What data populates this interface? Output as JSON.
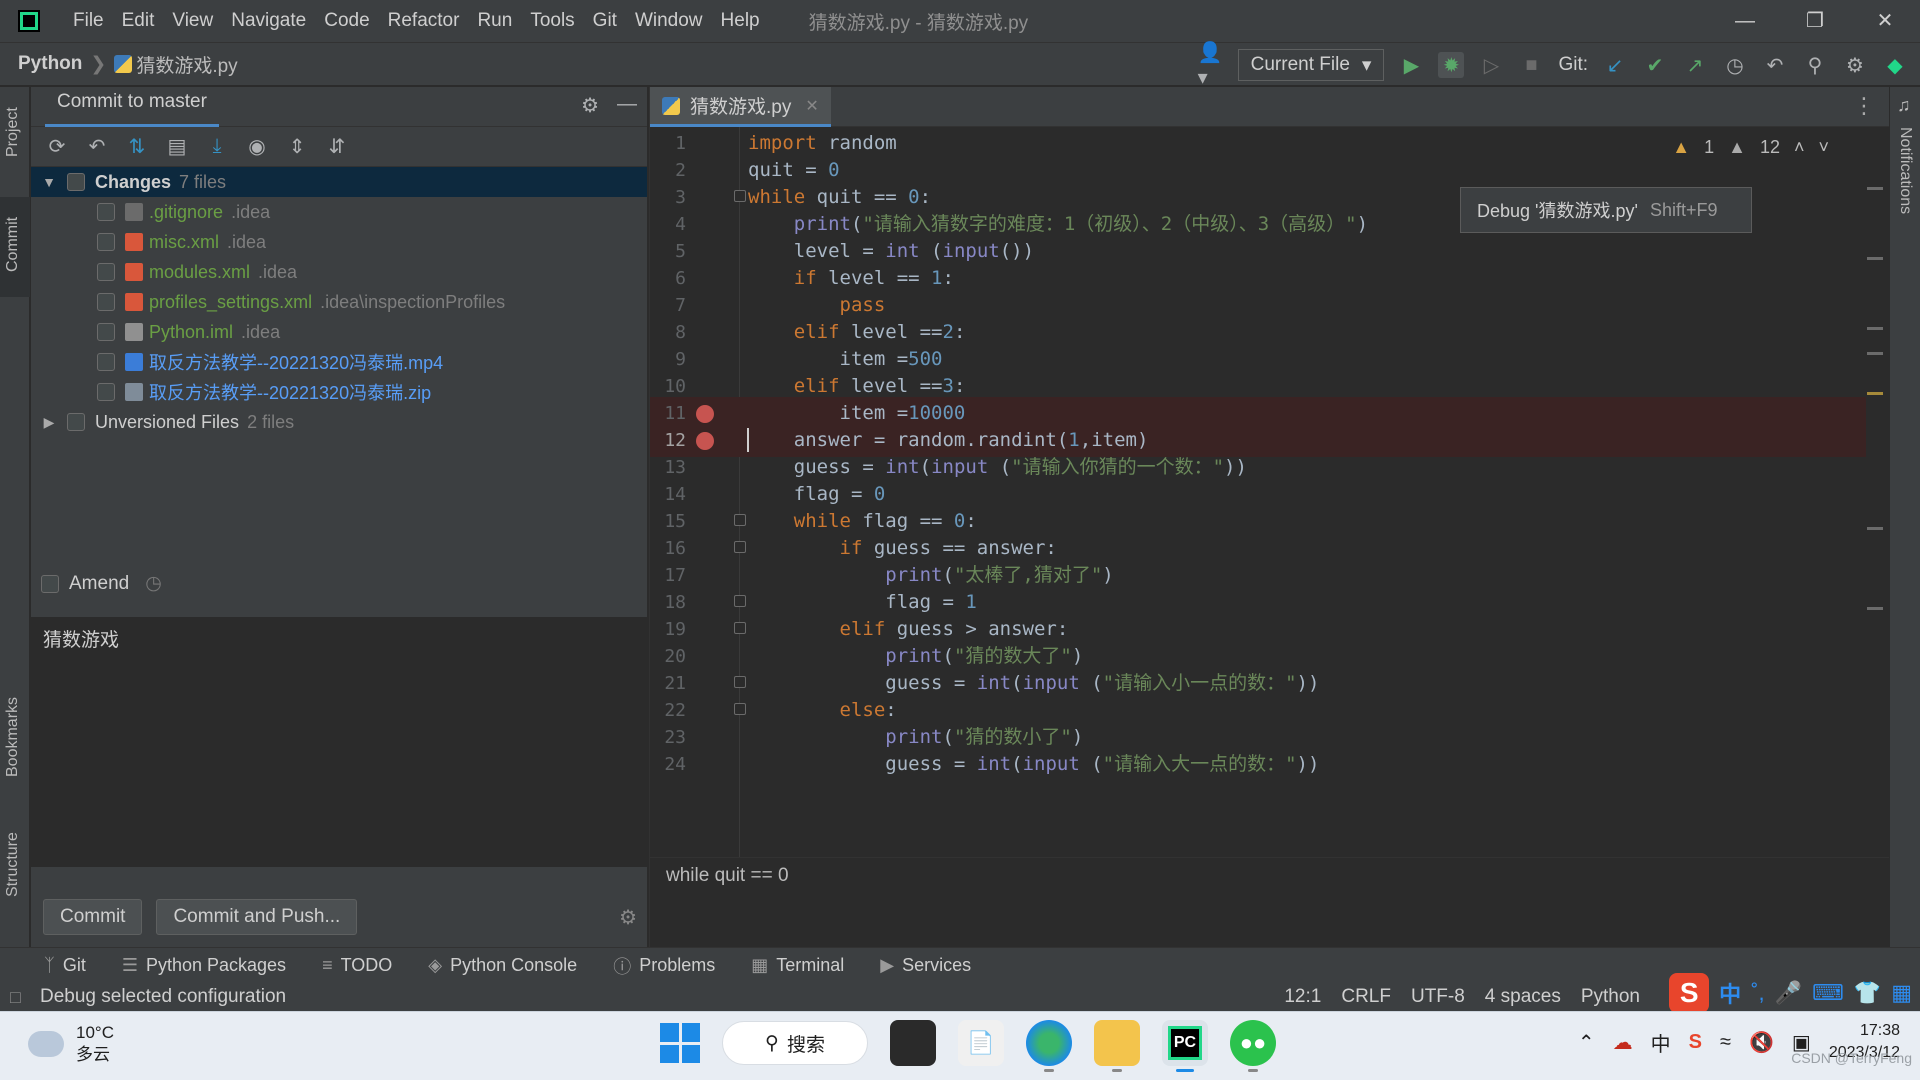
{
  "menu": [
    "File",
    "Edit",
    "View",
    "Navigate",
    "Code",
    "Refactor",
    "Run",
    "Tools",
    "Git",
    "Window",
    "Help"
  ],
  "window_title": "猜数游戏.py - 猜数游戏.py",
  "nav": {
    "project": "Python",
    "file": "猜数游戏.py"
  },
  "toolbar": {
    "run_config": "Current File",
    "git_label": "Git:"
  },
  "commit_panel": {
    "title": "Commit to master",
    "changes_label": "Changes",
    "changes_count": "7 files",
    "files": [
      {
        "name": ".gitignore",
        "path": ".idea",
        "icon": "gitignore-icon"
      },
      {
        "name": "misc.xml",
        "path": ".idea",
        "icon": "xml-icon"
      },
      {
        "name": "modules.xml",
        "path": ".idea",
        "icon": "xml-icon"
      },
      {
        "name": "profiles_settings.xml",
        "path": ".idea\\inspectionProfiles",
        "icon": "xml-icon"
      },
      {
        "name": "Python.iml",
        "path": ".idea",
        "icon": "iml-icon"
      },
      {
        "name": "取反方法教学--20221320冯泰瑞.mp4",
        "path": "",
        "icon": "video-icon"
      },
      {
        "name": "取反方法教学--20221320冯泰瑞.zip",
        "path": "",
        "icon": "zip-icon"
      }
    ],
    "unversioned_label": "Unversioned Files",
    "unversioned_count": "2 files",
    "amend_label": "Amend",
    "message": "猜数游戏",
    "commit_button": "Commit",
    "commit_push_button": "Commit and Push..."
  },
  "editor": {
    "tab": "猜数游戏.py",
    "tooltip_text": "Debug '猜数游戏.py'",
    "tooltip_shortcut": "Shift+F9",
    "warnings_a": "1",
    "warnings_b": "12",
    "lines": [
      "1",
      "2",
      "3",
      "4",
      "5",
      "6",
      "7",
      "8",
      "9",
      "10",
      "11",
      "12",
      "13",
      "14",
      "15",
      "16",
      "17",
      "18",
      "19",
      "20",
      "21",
      "22",
      "23",
      "24"
    ],
    "code": {
      "l1a": "import",
      "l1b": " random",
      "l2a": "quit",
      "l2b": " = ",
      "l2c": "0",
      "l3a": "while",
      "l3b": " quit == ",
      "l3c": "0",
      "l3d": ":",
      "l4a": "    print",
      "l4b": "(",
      "l4c": "\"请输入猜数字的难度：1（初级）、2（中级）、3（高级）\"",
      "l4d": ")",
      "l5a": "    level = ",
      "l5b": "int",
      "l5c": " (",
      "l5d": "input",
      "l5e": "())",
      "l6a": "    ",
      "l6b": "if",
      "l6c": " level == ",
      "l6d": "1",
      "l6e": ":",
      "l7a": "        ",
      "l7b": "pass",
      "l8a": "    ",
      "l8b": "elif",
      "l8c": " level ==",
      "l8d": "2",
      "l8e": ":",
      "l9a": "        item =",
      "l9b": "500",
      "l10a": "    ",
      "l10b": "elif",
      "l10c": " level ==",
      "l10d": "3",
      "l10e": ":",
      "l11a": "        item =",
      "l11b": "10000",
      "l12a": "    answer = random.randint(",
      "l12b": "1",
      "l12c": ",item)",
      "l13a": "    guess = ",
      "l13b": "int",
      "l13c": "(",
      "l13d": "input",
      "l13e": " (",
      "l13f": "\"请输入你猜的一个数：\"",
      "l13g": "))",
      "l14a": "    flag = ",
      "l14b": "0",
      "l15a": "    ",
      "l15b": "while",
      "l15c": " flag == ",
      "l15d": "0",
      "l15e": ":",
      "l16a": "        ",
      "l16b": "if",
      "l16c": " guess == answer:",
      "l17a": "            ",
      "l17b": "print",
      "l17c": "(",
      "l17d": "\"太棒了,猜对了\"",
      "l17e": ")",
      "l18a": "            flag = ",
      "l18b": "1",
      "l19a": "        ",
      "l19b": "elif",
      "l19c": " guess > answer:",
      "l20a": "            ",
      "l20b": "print",
      "l20c": "(",
      "l20d": "\"猜的数大了\"",
      "l20e": ")",
      "l21a": "            guess = ",
      "l21b": "int",
      "l21c": "(",
      "l21d": "input",
      "l21e": " (",
      "l21f": "\"请输入小一点的数：\"",
      "l21g": "))",
      "l22a": "        ",
      "l22b": "else",
      "l22c": ":",
      "l23a": "            ",
      "l23b": "print",
      "l23c": "(",
      "l23d": "\"猜的数小了\"",
      "l23e": ")",
      "l24a": "            guess = ",
      "l24b": "int",
      "l24c": "(",
      "l24d": "input",
      "l24e": " (",
      "l24f": "\"请输入大一点的数：\"",
      "l24g": "))"
    },
    "breadcrumb": "while quit == 0"
  },
  "left_stripe": {
    "project": "Project",
    "commit": "Commit",
    "bookmarks": "Bookmarks",
    "structure": "Structure"
  },
  "right_stripe": {
    "notifications": "Notifications"
  },
  "tool_windows": [
    "Git",
    "Python Packages",
    "TODO",
    "Python Console",
    "Problems",
    "Terminal",
    "Services"
  ],
  "status": {
    "message": "Debug selected configuration",
    "position": "12:1",
    "line_sep": "CRLF",
    "encoding": "UTF-8",
    "indent": "4 spaces",
    "interpreter": "Python"
  },
  "taskbar": {
    "temp": "10°C",
    "weather": "多云",
    "search": "搜索",
    "time": "17:38",
    "date": "2023/3/12",
    "ime_lang": "中"
  },
  "watermark": "CSDN @TerryFeng"
}
